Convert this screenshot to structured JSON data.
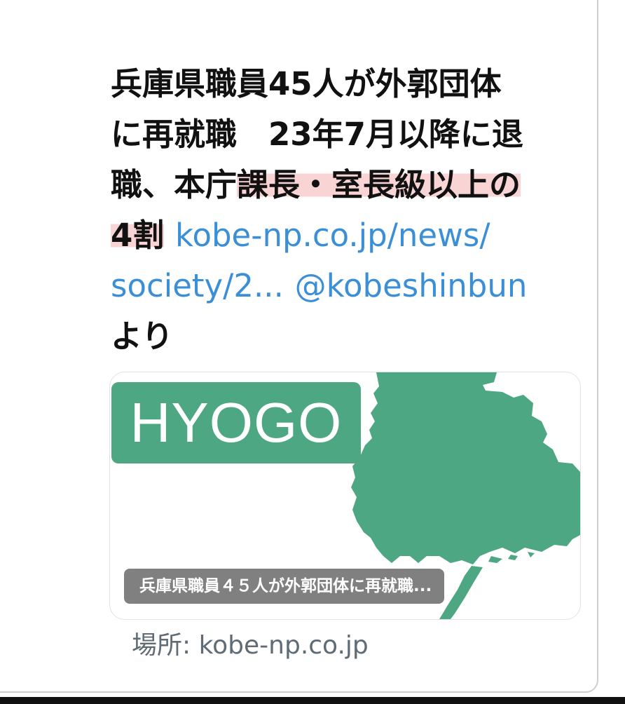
{
  "tweet": {
    "lines": [
      "兵庫県職員45人が外郭団体",
      "に再就職　23年7月以降に退",
      "職、本庁",
      "課長・室長級以上の",
      "4割",
      "kobe-np.co.jp/news/",
      "society/2...",
      "@kobeshinbun",
      "より"
    ]
  },
  "card": {
    "badge_text": "HYOGO",
    "caption": "兵庫県職員４５人が外郭団体に再就職...",
    "location": "場所: kobe-np.co.jp"
  },
  "colors": {
    "link": "#3b8fd6",
    "highlight": "#f9d4d4",
    "map_green": "#4ea783",
    "caption_bg": "#6e6e6e"
  }
}
